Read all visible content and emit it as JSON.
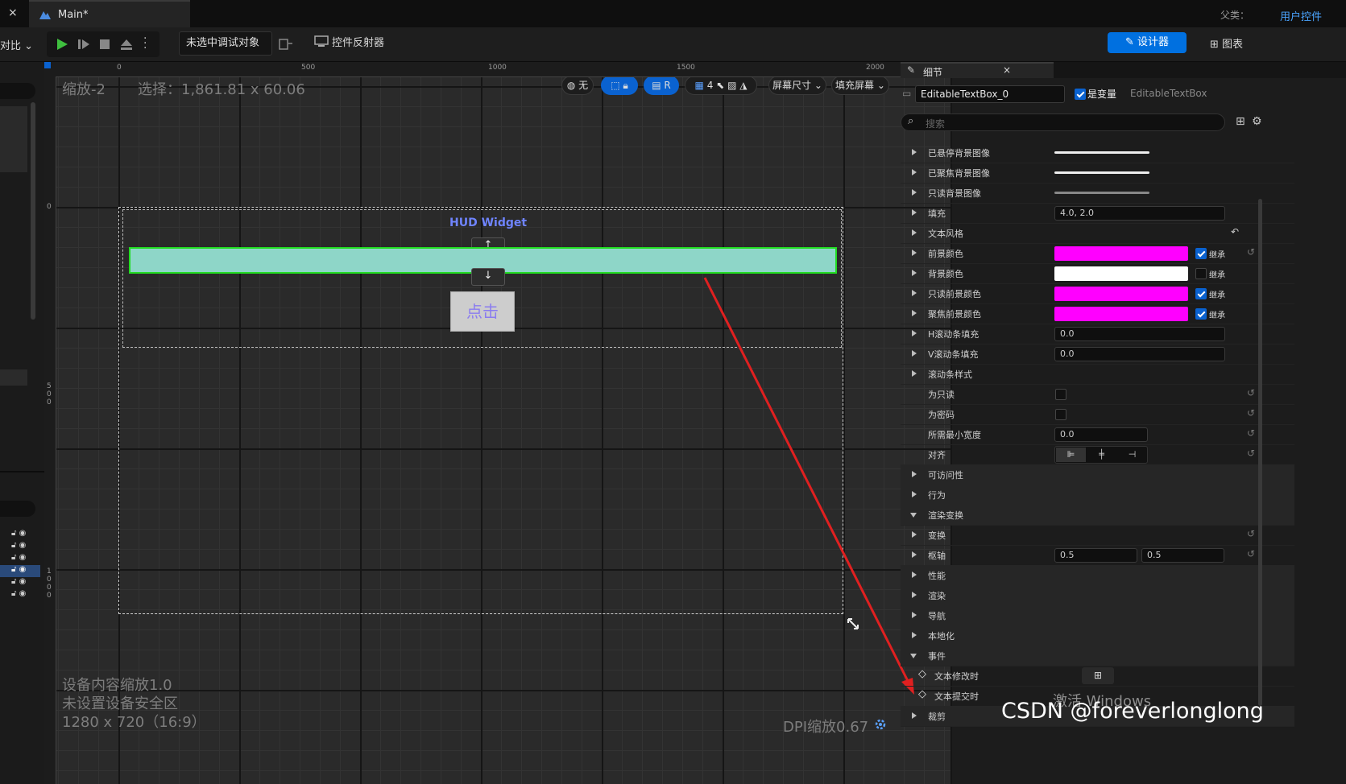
{
  "tabbar": {
    "close": "×",
    "tab_title": "Main*",
    "parent_label": "父类：",
    "parent_value": "用户控件"
  },
  "toolbar": {
    "compare_label": "对比",
    "debug_dropdown": "未选中调试对象",
    "reflector_label": "控件反射器",
    "designer_label": "设计器",
    "graph_label": "图表"
  },
  "canvas": {
    "zoom": "缩放-2",
    "selection": "选择：1,861.81 x 60.06",
    "widget_label": "HUD Widget",
    "button_text": "点击",
    "up_arrow": "↑",
    "down_arrow": "↓",
    "bottom_info": [
      "设备内容缩放1.0",
      "未设置设备安全区",
      "1280 x 720（16:9）"
    ],
    "dpi": "DPI缩放0.67",
    "ruler_top": [
      "0",
      "500",
      "1000",
      "1500",
      "2000"
    ],
    "ruler_left": [
      "0",
      "5\n0\n0",
      "1\n0\n0\n0"
    ],
    "vp_toolbar": {
      "none_label": "无",
      "r_label": "R",
      "grid_num": "4",
      "screen_size": "屏幕尺寸",
      "fill_screen": "填充屏幕"
    }
  },
  "details": {
    "tab_title": "细节",
    "tab_close": "×",
    "name_value": "EditableTextBox_0",
    "is_variable": "是变量",
    "class_name": "EditableTextBox",
    "search_placeholder": "搜索",
    "rows": [
      {
        "label": "已悬停背景图像"
      },
      {
        "label": "已聚焦背景图像"
      },
      {
        "label": "只读背景图像"
      },
      {
        "label": "填充",
        "value": "4.0, 2.0"
      },
      {
        "label": "文本风格"
      },
      {
        "label": "前景颜色",
        "inherit": "继承"
      },
      {
        "label": "背景颜色",
        "inherit": "继承"
      },
      {
        "label": "只读前景颜色",
        "inherit": "继承"
      },
      {
        "label": "聚焦前景颜色",
        "inherit": "继承"
      },
      {
        "label": "H滚动条填充",
        "value": "0.0"
      },
      {
        "label": "V滚动条填充",
        "value": "0.0"
      },
      {
        "label": "滚动条样式"
      },
      {
        "label": "为只读"
      },
      {
        "label": "为密码"
      },
      {
        "label": "所需最小宽度",
        "value": "0.0"
      },
      {
        "label": "对齐"
      },
      {
        "label": "可访问性"
      },
      {
        "label": "行为"
      },
      {
        "label": "渲染变换"
      },
      {
        "label": "变换"
      },
      {
        "label": "枢轴",
        "value1": "0.5",
        "value2": "0.5"
      },
      {
        "label": "性能"
      },
      {
        "label": "渲染"
      },
      {
        "label": "导航"
      },
      {
        "label": "本地化"
      },
      {
        "label": "事件"
      },
      {
        "label": "文本修改时"
      },
      {
        "label": "文本提交时"
      },
      {
        "label": "裁剪"
      }
    ]
  },
  "watermark": {
    "activate": "激活 Windows",
    "csdn": "CSDN @foreverlonglong"
  },
  "colors": {
    "accent": "#0a62d0",
    "magenta": "#ff00ff",
    "textbox_fill": "#8ed6c8",
    "textbox_border": "#22dd22",
    "arrow": "#e02020"
  }
}
